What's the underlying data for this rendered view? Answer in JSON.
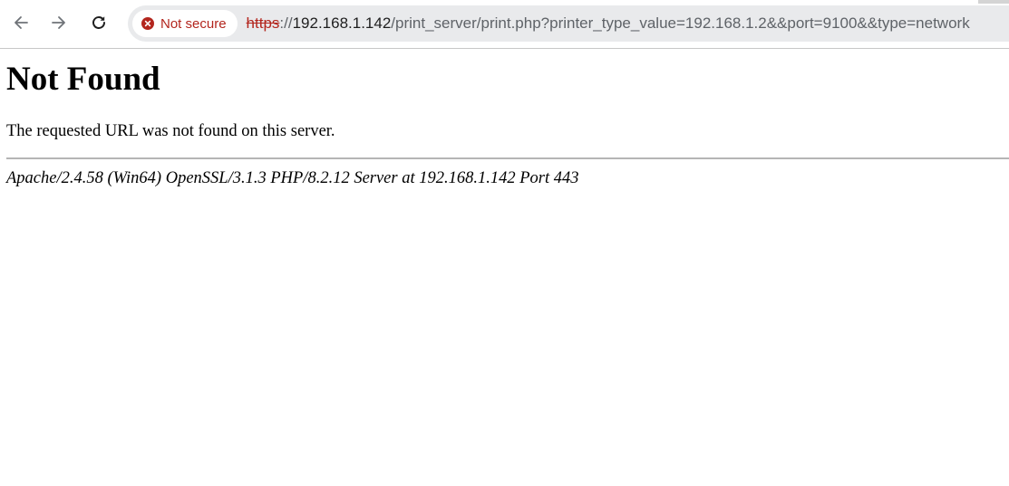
{
  "browser": {
    "nav": {
      "back_icon": "arrow-left-icon",
      "forward_icon": "arrow-right-icon",
      "reload_icon": "reload-icon"
    },
    "security": {
      "icon": "error-circle-icon",
      "label": "Not secure",
      "color": "#b3261e"
    },
    "url": {
      "scheme": "https",
      "separator": "://",
      "host": "192.168.1.142",
      "path": "/print_server/print.php?printer_type_value=192.168.1.2&&port=9100&&type=network"
    }
  },
  "page": {
    "heading": "Not Found",
    "message": "The requested URL was not found on this server.",
    "server_signature": "Apache/2.4.58 (Win64) OpenSSL/3.1.3 PHP/8.2.12 Server at 192.168.1.142 Port 443"
  }
}
